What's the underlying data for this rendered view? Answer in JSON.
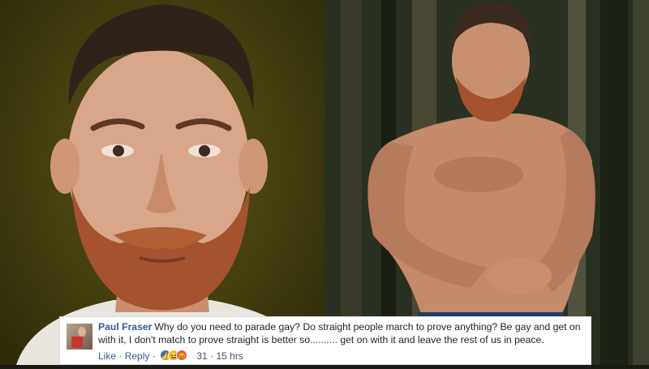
{
  "comment": {
    "author": "Paul Fraser",
    "text": "Why do you need to parade gay? Do straight people march to prove anything? Be gay and get on with it, I don't match to prove straight is better so.......... get on with it and leave the rest of us in peace.",
    "like_label": "Like",
    "reply_label": "Reply",
    "separator": "·",
    "reaction_count": "31",
    "timestamp": "15 hrs",
    "reactions": [
      "like-icon",
      "haha-icon",
      "angry-icon"
    ]
  },
  "left_photo": {
    "subject": "portrait-photo"
  },
  "right_photo": {
    "subject": "forest-shirtless-photo"
  },
  "colors": {
    "link": "#365899",
    "text": "#1d2129",
    "meta": "#4b4f56"
  }
}
